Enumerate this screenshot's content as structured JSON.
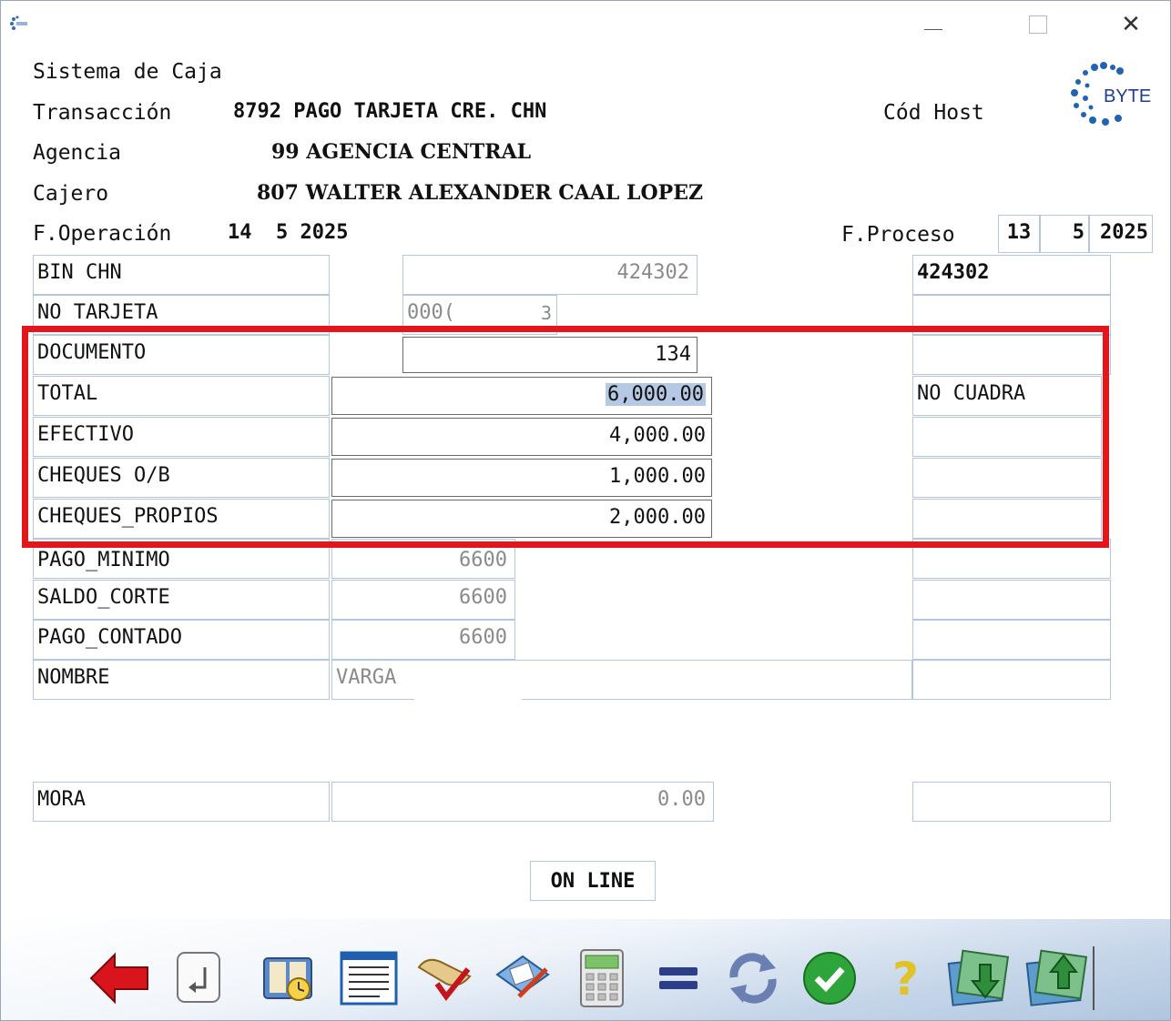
{
  "app": {
    "title": "Sistema de Caja",
    "logo_text": "BYTE",
    "icon": "byte-app-icon"
  },
  "window_controls": {
    "minimize": "minimize-icon",
    "maximize": "maximize-icon",
    "close": "close-icon"
  },
  "header": {
    "transaccion_label": "Transacción",
    "transaccion_value": "8792 PAGO TARJETA CRE. CHN",
    "cod_host_label": "Cód Host",
    "agencia_label": "Agencia",
    "agencia_value": "99 AGENCIA CENTRAL",
    "cajero_label": "Cajero",
    "cajero_value": "807 WALTER ALEXANDER CAAL LOPEZ",
    "f_operacion_label": "F.Operación",
    "f_operacion_value": "14  5 2025",
    "f_proceso_label": "F.Proceso",
    "f_proceso_day": "13",
    "f_proceso_month": "5",
    "f_proceso_year": "2025"
  },
  "fields": {
    "bin_chn": {
      "label": "BIN CHN",
      "value": "424302",
      "side": "424302"
    },
    "no_tarjeta": {
      "label": "NO TARJETA",
      "value": "000(",
      "value2": "3"
    },
    "documento": {
      "label": "DOCUMENTO",
      "value": "134"
    },
    "total": {
      "label": "TOTAL",
      "value": "6,000.00",
      "side": "NO CUADRA"
    },
    "efectivo": {
      "label": "EFECTIVO",
      "value": "4,000.00"
    },
    "cheques_ob": {
      "label": "CHEQUES O/B",
      "value": "1,000.00"
    },
    "cheques_propios": {
      "label": "CHEQUES_PROPIOS",
      "value": "2,000.00"
    },
    "pago_minimo": {
      "label": "PAGO_MINIMO",
      "value": "6600"
    },
    "saldo_corte": {
      "label": "SALDO_CORTE",
      "value": "6600"
    },
    "pago_contado": {
      "label": "PAGO_CONTADO",
      "value": "6600"
    },
    "nombre": {
      "label": "NOMBRE",
      "value": "VARGA"
    },
    "mora": {
      "label": "MORA",
      "value": "0.00"
    }
  },
  "status": {
    "online": "ON LINE"
  },
  "colors": {
    "highlight_box": "#e5161b",
    "field_border": "#b3c7e3",
    "selection": "#b5c8e4"
  },
  "toolbar": [
    {
      "icon": "back-arrow-icon"
    },
    {
      "icon": "enter-key-icon"
    },
    {
      "icon": "book-clock-icon"
    },
    {
      "icon": "document-list-icon"
    },
    {
      "icon": "scroll-check-icon"
    },
    {
      "icon": "edit-document-icon"
    },
    {
      "icon": "calculator-icon"
    },
    {
      "icon": "equals-icon"
    },
    {
      "icon": "refresh-icon"
    },
    {
      "icon": "check-icon"
    },
    {
      "icon": "help-icon"
    },
    {
      "icon": "money-down-icon"
    },
    {
      "icon": "money-up-icon"
    }
  ]
}
